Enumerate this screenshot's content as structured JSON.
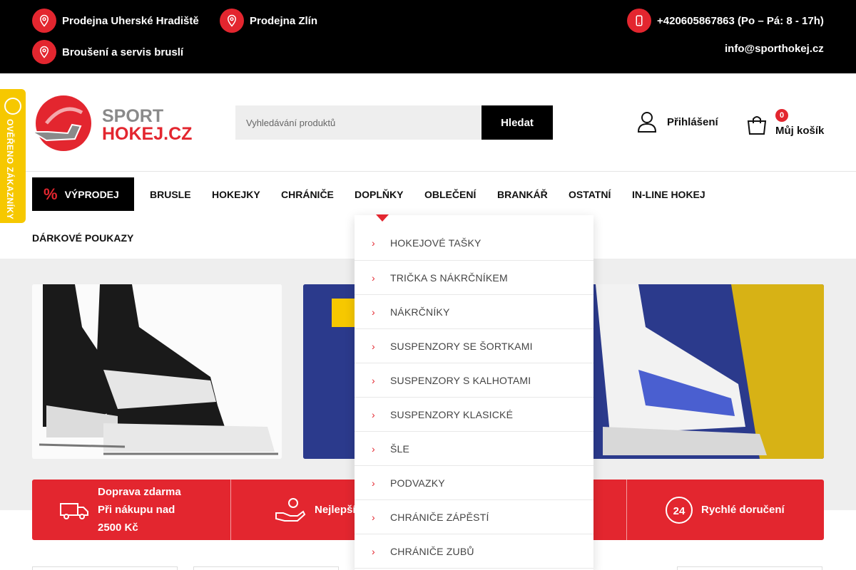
{
  "topbar": {
    "store1": "Prodejna Uherské Hradiště",
    "store2": "Prodejna Zlín",
    "service": "Broušení a servis bruslí",
    "phone": "+420605867863 (Po – Pá: 8 - 17h)",
    "email": "info@sporthokej.cz"
  },
  "header": {
    "logo_line1": "SPORT",
    "logo_line2": "HOKEJ.CZ",
    "search_placeholder": "Vyhledávání produktů",
    "search_button": "Hledat",
    "login": "Přihlášení",
    "cart_count": "0",
    "cart_label": "Můj košík"
  },
  "verified_badge": "OVĚŘENO ZÁKAZNÍKY",
  "nav": {
    "sale": "VÝPRODEJ",
    "items": [
      "BRUSLE",
      "HOKEJKY",
      "CHRÁNIČE",
      "DOPLŇKY",
      "OBLEČENÍ",
      "BRANKÁŘ",
      "OSTATNÍ",
      "IN-LINE HOKEJ"
    ],
    "row2": [
      "DÁRKOVÉ POUKAZY"
    ]
  },
  "dropdown": {
    "items": [
      "HOKEJOVÉ TAŠKY",
      "TRIČKA S NÁKRČNÍKEM",
      "NÁKRČNÍKY",
      "SUSPENZORY SE ŠORTKAMI",
      "SUSPENZORY S KALHOTAMI",
      "SUSPENZORY KLASICKÉ",
      "ŠLE",
      "PODVAZKY",
      "CHRÁNIČE ZÁPĚSTÍ",
      "CHRÁNIČE ZUBŮ"
    ]
  },
  "features": {
    "shipping_line1": "Doprava zdarma",
    "shipping_line2": "Při nákupu nad",
    "shipping_line3": "2500 Kč",
    "best_price": "Nejlepší",
    "fast_delivery": "Rychlé doručení"
  },
  "colors": {
    "accent": "#e3262f",
    "dark": "#000000",
    "badge": "#f6c800"
  }
}
